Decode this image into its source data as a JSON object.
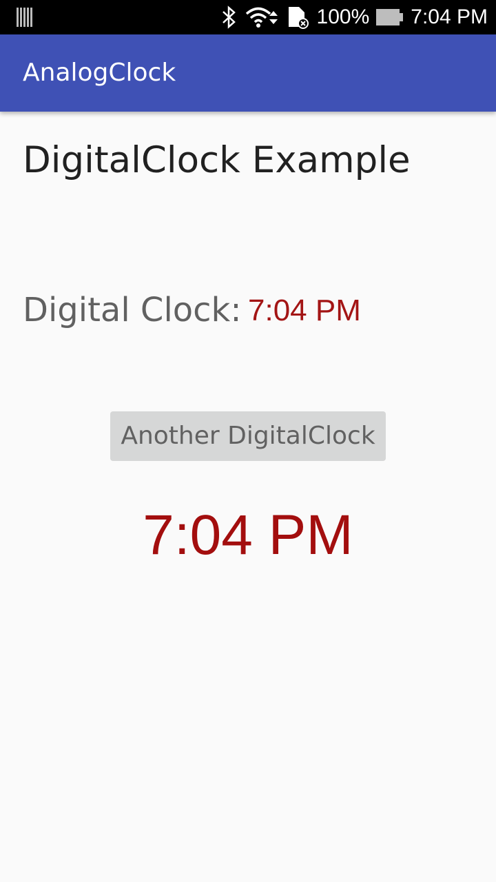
{
  "status_bar": {
    "battery_percent": "100%",
    "time": "7:04 PM",
    "icons": [
      "barcode-icon",
      "bluetooth-icon",
      "wifi-icon",
      "sd-card-icon",
      "battery-icon"
    ]
  },
  "app_bar": {
    "title": "AnalogClock",
    "color": "#3f51b5"
  },
  "main": {
    "heading": "DigitalClock Example",
    "clock_label": "Digital Clock:",
    "clock_value": "7:04 PM",
    "button_label": "Another DigitalClock",
    "big_clock_value": "7:04 PM",
    "clock_color": "#a30e0e"
  }
}
